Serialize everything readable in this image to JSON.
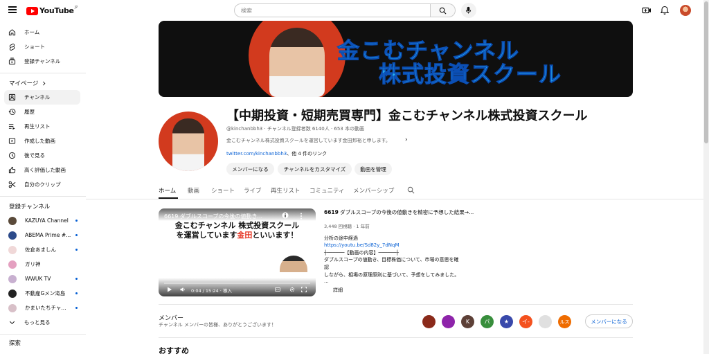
{
  "topbar": {
    "logo_text": "YouTube",
    "logo_sup": "JP",
    "search_placeholder": "検索"
  },
  "sidebar": {
    "main_items": [
      {
        "label": "ホーム",
        "icon": "home-icon"
      },
      {
        "label": "ショート",
        "icon": "shorts-icon"
      },
      {
        "label": "登録チャンネル",
        "icon": "subscriptions-icon"
      }
    ],
    "my_page_title": "マイページ",
    "my_page_items": [
      {
        "label": "チャンネル",
        "icon": "channel-icon",
        "active": true
      },
      {
        "label": "履歴",
        "icon": "history-icon"
      },
      {
        "label": "再生リスト",
        "icon": "playlist-icon"
      },
      {
        "label": "作成した動画",
        "icon": "your-videos-icon"
      },
      {
        "label": "後で見る",
        "icon": "watch-later-icon"
      },
      {
        "label": "高く評価した動画",
        "icon": "liked-icon"
      },
      {
        "label": "自分のクリップ",
        "icon": "clips-icon"
      }
    ],
    "subscriptions_title": "登録チャンネル",
    "subscriptions": [
      {
        "label": "KAZUYA Channel",
        "color": "#5a4a3a"
      },
      {
        "label": "ABEMA Prime #...",
        "color": "#2c4a8a"
      },
      {
        "label": "佐倉あましん",
        "color": "#f0d8d8"
      },
      {
        "label": "ガリ神",
        "color": "#e4a0c0"
      },
      {
        "label": "WWUK TV",
        "color": "#c8b0d0"
      },
      {
        "label": "不動産Gメン滝島",
        "color": "#222222"
      },
      {
        "label": "かまいたちチャ...",
        "color": "#d8c0c8"
      }
    ],
    "show_more": "もっと見る",
    "explore_title": "探索"
  },
  "channel": {
    "banner_line1": "金こむチャンネル",
    "banner_line2": "株式投資スクール",
    "name": "【中期投資・短期売買専門】金こむチャンネル株式投資スクール",
    "meta": "@kinchanbbh3 · チャンネル登録者数 6140人 · 653 本の動画",
    "description": "金こむチャンネル株式投資スクールを運営しています金田邦裕と申します。",
    "link": "twitter.com/kinchanbbh3",
    "link_more": "、他 4 件のリンク",
    "buttons": [
      "メンバーになる",
      "チャンネルをカスタマイズ",
      "動画を管理"
    ]
  },
  "tabs": [
    "ホーム",
    "動画",
    "ショート",
    "ライブ",
    "再生リスト",
    "コミュニティ",
    "メンバーシップ"
  ],
  "featured_video": {
    "overlay_title": "6619 ダブルスコープの今後の値動き...",
    "caption_line1": "金こむチャンネル 株式投資スクール",
    "caption_line2_a": "を運営しています",
    "caption_line2_red": "金田",
    "caption_line2_b": "といいます！",
    "time": "0:04 / 15:24 · 導入",
    "title_num": "6619",
    "title_text": " ダブルスコープの今後の値動きを精密に予想した結果→...",
    "stats": "3,448 回視聴 · 1 年前",
    "desc_lines": [
      "分析の途中経過",
      "https://youtu.be/Sd82y_7dNqM",
      "┼──────【動画の内容】──────┼",
      "ダブルスコープの値動き、目標株価について、市場の意思を確",
      "認",
      "しながら、相場の原理原則に基づいて、予想をしてみました。",
      "..."
    ],
    "more": "詳細"
  },
  "members": {
    "title": "メンバー",
    "subtitle": "チャンネル メンバーの皆様、ありがとうございます！",
    "avatars": [
      {
        "text": "",
        "color": "#8a2a1a"
      },
      {
        "text": "",
        "color": "#8e24aa"
      },
      {
        "text": "K",
        "color": "#5d4037"
      },
      {
        "text": "パ",
        "color": "#388e3c"
      },
      {
        "text": "★",
        "color": "#3949ab"
      },
      {
        "text": "イ-",
        "color": "#f4511e"
      },
      {
        "text": "",
        "color": "#e0e0e0"
      },
      {
        "text": "ルス",
        "color": "#ef6c00"
      }
    ],
    "button": "メンバーになる"
  },
  "recommend_title": "おすすめ"
}
